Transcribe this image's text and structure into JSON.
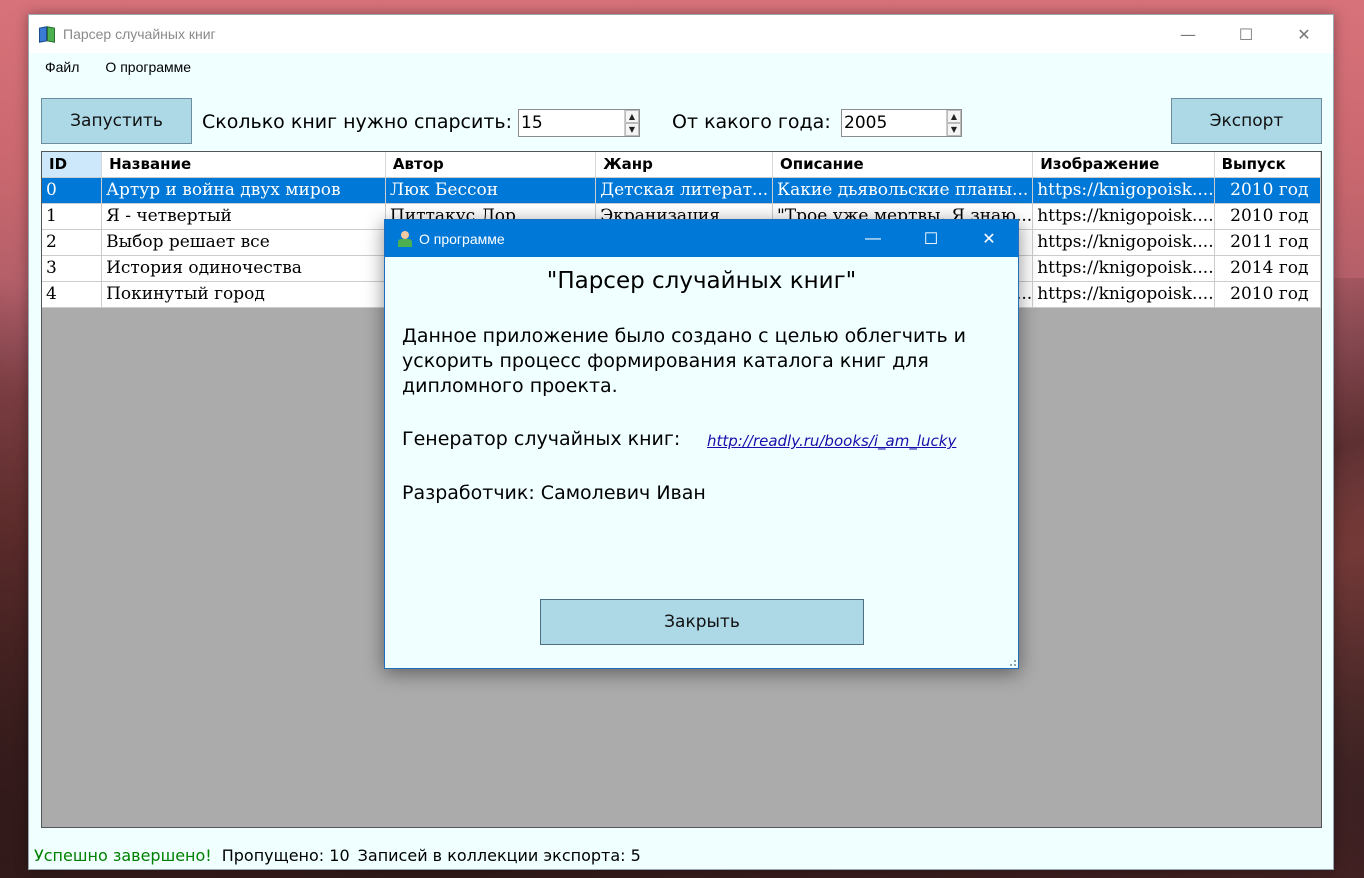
{
  "window": {
    "title": "Парсер случайных книг",
    "controls": {
      "minimize": "—",
      "maximize": "☐",
      "close": "✕"
    }
  },
  "menu": {
    "file": "Файл",
    "about": "О программе"
  },
  "toolbar": {
    "run_label": "Запустить",
    "count_label": "Сколько книг нужно спарсить:",
    "count_value": "15",
    "year_label": "От какого года:",
    "year_value": "2005",
    "export_label": "Экспорт"
  },
  "table": {
    "columns": [
      "ID",
      "Название",
      "Автор",
      "Жанр",
      "Описание",
      "Изображение",
      "Выпуск"
    ],
    "rows": [
      [
        "0",
        "Артур и война двух миров",
        "Люк Бессон",
        "Детская литерат...",
        "Какие дьявольские планы...",
        "https://knigopoisk....",
        "2010 год"
      ],
      [
        "1",
        "Я - четвертый",
        "Питтакус Лор",
        "Экранизация",
        "\"Трое уже мертвы. Я знаю...",
        "https://knigopoisk....",
        "2010 год"
      ],
      [
        "2",
        "Выбор решает все",
        "",
        "",
        "",
        "https://knigopoisk....",
        "2011 год"
      ],
      [
        "3",
        "История одиночества",
        "",
        "",
        "",
        "https://knigopoisk....",
        "2014 год"
      ],
      [
        "4",
        "Покинутый город",
        "",
        "",
        "...",
        "https://knigopoisk....",
        "2010 год"
      ]
    ],
    "selected_row": 0
  },
  "status": {
    "ok": "Успешно завершено!",
    "skipped": "Пропущено: 10",
    "records": "Записей в коллекции экспорта: 5"
  },
  "dialog": {
    "title": "О программе",
    "heading": "\"Парсер случайных книг\"",
    "body": "Данное приложение было создано с целью облегчить и ускорить процесс формирования каталога книг для дипломного проекта.",
    "generator_label": "Генератор случайных книг:",
    "generator_link": "http://readly.ru/books/i_am_lucky",
    "developer": "Разработчик: Самолевич Иван",
    "close_label": "Закрыть",
    "controls": {
      "minimize": "—",
      "maximize": "☐",
      "close": "✕"
    }
  },
  "colors": {
    "accent": "#0078d7",
    "button_bg": "#add8e6",
    "window_bg": "#f0ffff",
    "status_ok": "#008000"
  }
}
